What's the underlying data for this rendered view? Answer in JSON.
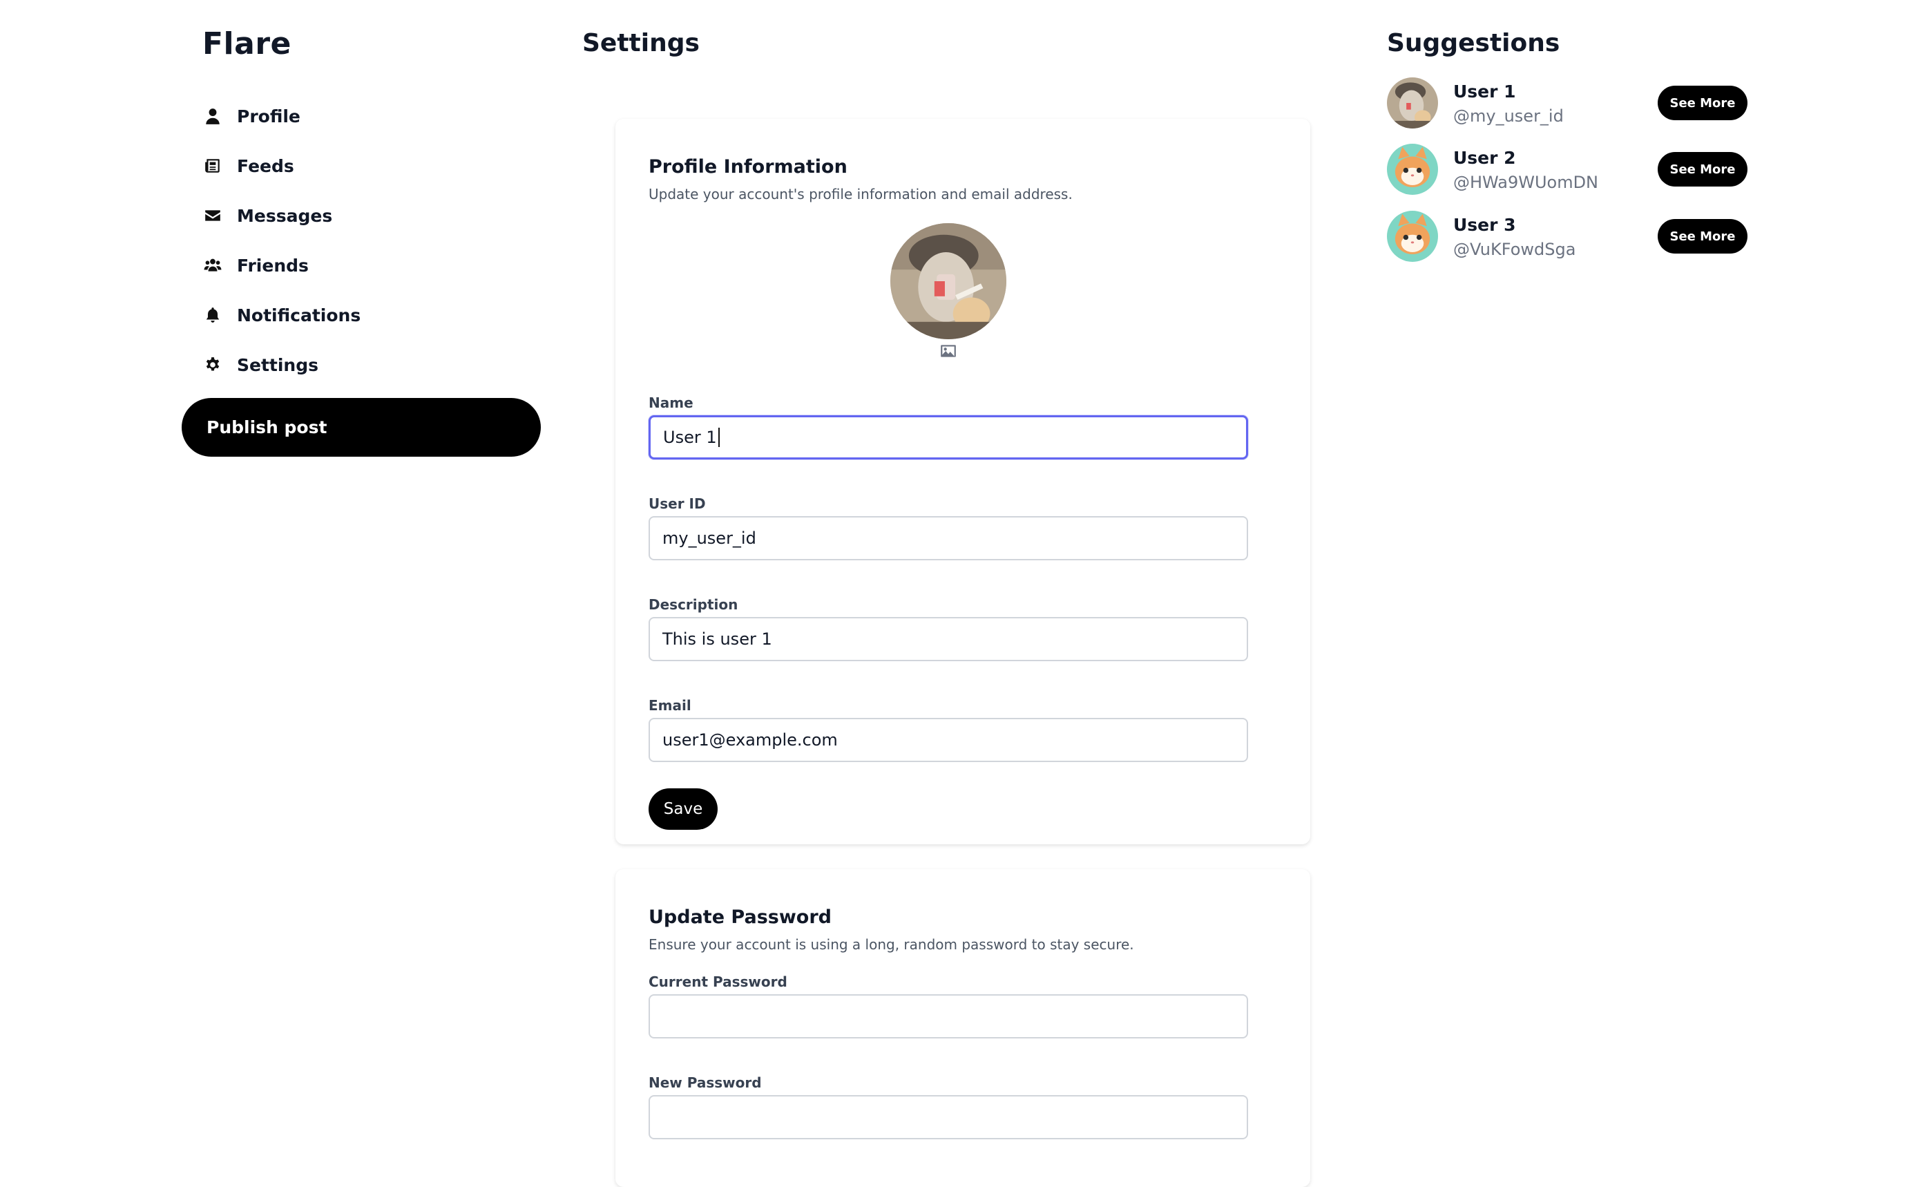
{
  "app": {
    "logo": "Flare"
  },
  "sidebar": {
    "items": [
      {
        "label": "Profile",
        "icon": "user-icon"
      },
      {
        "label": "Feeds",
        "icon": "newspaper-icon"
      },
      {
        "label": "Messages",
        "icon": "envelope-icon"
      },
      {
        "label": "Friends",
        "icon": "users-icon"
      },
      {
        "label": "Notifications",
        "icon": "bell-icon"
      },
      {
        "label": "Settings",
        "icon": "gear-icon"
      }
    ],
    "publish_label": "Publish post"
  },
  "main": {
    "title": "Settings",
    "profile": {
      "heading": "Profile Information",
      "subtext": "Update your account's profile information and email address.",
      "fields": {
        "name": {
          "label": "Name",
          "value": "User 1"
        },
        "user_id": {
          "label": "User ID",
          "value": "my_user_id"
        },
        "description": {
          "label": "Description",
          "value": "This is user 1"
        },
        "email": {
          "label": "Email",
          "value": "user1@example.com"
        }
      },
      "save_label": "Save"
    },
    "password": {
      "heading": "Update Password",
      "subtext": "Ensure your account is using a long, random password to stay secure.",
      "fields": {
        "current": {
          "label": "Current Password",
          "value": ""
        },
        "new": {
          "label": "New Password",
          "value": ""
        }
      }
    }
  },
  "suggestions": {
    "title": "Suggestions",
    "users": [
      {
        "name": "User 1",
        "handle": "@my_user_id",
        "button": "See More",
        "avatar": "statue"
      },
      {
        "name": "User 2",
        "handle": "@HWa9WUomDN",
        "button": "See More",
        "avatar": "cat"
      },
      {
        "name": "User 3",
        "handle": "@VuKFowdSga",
        "button": "See More",
        "avatar": "cat"
      }
    ]
  },
  "colors": {
    "accent": "#6366f1",
    "button": "#000000",
    "muted": "#6b7280"
  }
}
